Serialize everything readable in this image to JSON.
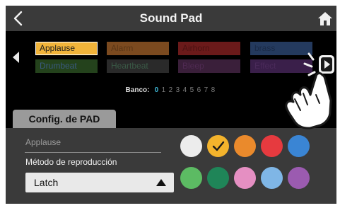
{
  "header": {
    "title": "Sound Pad",
    "back_icon": "chevron-left-icon",
    "home_icon": "home-icon"
  },
  "pads": [
    {
      "label": "Applause",
      "bg": "#f1b43a",
      "fg": "#1a1a1a",
      "selected": true
    },
    {
      "label": "Alarm",
      "bg": "#7b4a1f",
      "fg": "#5a3616"
    },
    {
      "label": "Airhorn",
      "bg": "#6b1a1a",
      "fg": "#4a1212"
    },
    {
      "label": "brass",
      "bg": "#243a5e",
      "fg": "#1a2a46"
    },
    {
      "label": "Drumbeat",
      "bg": "#24421c",
      "fg": "#3a5a80"
    },
    {
      "label": "Heartbeat",
      "bg": "#2a2a2a",
      "fg": "#3a5a46"
    },
    {
      "label": "Bleep",
      "bg": "#3a1f3a",
      "fg": "#4f2a52"
    },
    {
      "label": "Effect",
      "bg": "#3a1f4a",
      "fg": "#4a2a5a"
    }
  ],
  "bank": {
    "label": "Banco:",
    "numbers": [
      "0",
      "1",
      "2",
      "3",
      "4",
      "5",
      "6",
      "7",
      "8"
    ],
    "active": "0"
  },
  "tab": {
    "label": "Config. de PAD"
  },
  "config": {
    "pad_name": "Applause",
    "method_label": "Método de reproducción",
    "method_value": "Latch"
  },
  "colors": [
    {
      "name": "white",
      "hex": "#ececec"
    },
    {
      "name": "yellow",
      "hex": "#f3b32c",
      "selected": true
    },
    {
      "name": "orange",
      "hex": "#ea8a2c"
    },
    {
      "name": "red",
      "hex": "#e63a3f"
    },
    {
      "name": "blue",
      "hex": "#3a85d4"
    },
    {
      "name": "green",
      "hex": "#5cbb63"
    },
    {
      "name": "dark-green",
      "hex": "#1f8558"
    },
    {
      "name": "pink",
      "hex": "#e58fc2"
    },
    {
      "name": "light-blue",
      "hex": "#7fb6e6"
    },
    {
      "name": "purple",
      "hex": "#9b5bb0"
    }
  ],
  "icons": {
    "left_arrow": "triangle-left-icon",
    "right_arrow": "next-arrow-button-icon",
    "hand": "tapping-hand-icon",
    "select_arrow": "triangle-up-icon",
    "check": "check-icon"
  }
}
